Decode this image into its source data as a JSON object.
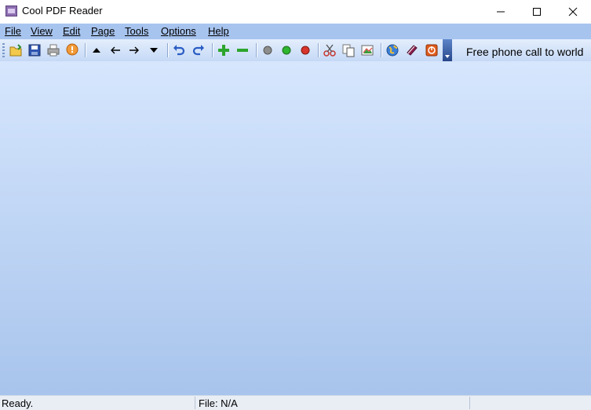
{
  "window": {
    "title": "Cool PDF Reader"
  },
  "menu": [
    "File",
    "View",
    "Edit",
    "Page",
    "Tools",
    "Options",
    "Help"
  ],
  "toolbar": {
    "promo_text": "Free phone call to world",
    "buttons": [
      "open-icon",
      "save-icon",
      "print-icon",
      "info-icon",
      "first-page-icon",
      "back-icon",
      "forward-icon",
      "last-page-icon",
      "undo-icon",
      "redo-icon",
      "zoom-in-icon",
      "zoom-out-icon",
      "gray-circle-icon",
      "green-circle-icon",
      "red-circle-icon",
      "cut-icon",
      "copy-icon",
      "image-icon",
      "globe-icon",
      "book-icon",
      "power-icon"
    ]
  },
  "status": {
    "left": "Ready.",
    "file": "File: N/A"
  },
  "colors": {
    "menubar": "#a7c4ef",
    "workarea_top": "#d6e6fd",
    "workarea_bottom": "#a8c4ec"
  }
}
